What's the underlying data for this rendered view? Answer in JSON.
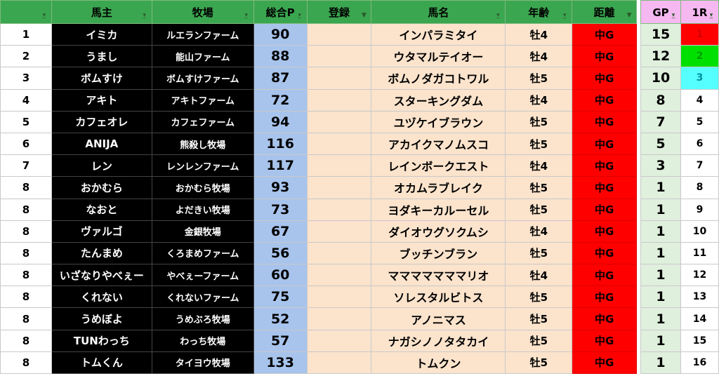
{
  "header": {
    "col_rank": "",
    "col_owner": "馬主",
    "col_farm": "牧場",
    "col_points": "総合P",
    "col_register": "登録",
    "col_horse": "馬名",
    "col_age": "年齢",
    "col_distance": "距離",
    "col_gp": "GP",
    "col_1r": "1R"
  },
  "icons": {
    "filter": "dropdown-filter-icon",
    "filter_active": "funnel-filter-icon"
  },
  "colors": {
    "header_green": "#3ba650",
    "header_pink": "#f5b8f0",
    "owner_bg": "#000000",
    "points_bg": "#a8c4ec",
    "horse_bg": "#fbe3cc",
    "distance_red": "#ff0000",
    "gp_bg": "#dff0dd",
    "rank1": "#ff0000",
    "rank2": "#00e000",
    "rank3": "#55ffff"
  },
  "rows": [
    {
      "rank": "1",
      "owner": "イミカ",
      "farm": "ルエランファーム",
      "points": "90",
      "register": "",
      "horse": "インパラミタイ",
      "age": "牡4",
      "distance": "中G",
      "gp": "15",
      "r1": "1"
    },
    {
      "rank": "2",
      "owner": "うまし",
      "farm": "能山ファーム",
      "points": "88",
      "register": "",
      "horse": "ウタマルテイオー",
      "age": "牡4",
      "distance": "中G",
      "gp": "12",
      "r1": "2"
    },
    {
      "rank": "3",
      "owner": "ボムすけ",
      "farm": "ボムすけファーム",
      "points": "87",
      "register": "",
      "horse": "ボムノダガコトワル",
      "age": "牡5",
      "distance": "中G",
      "gp": "10",
      "r1": "3"
    },
    {
      "rank": "4",
      "owner": "アキト",
      "farm": "アキトファーム",
      "points": "72",
      "register": "",
      "horse": "スターキングダム",
      "age": "牡4",
      "distance": "中G",
      "gp": "8",
      "r1": "4"
    },
    {
      "rank": "5",
      "owner": "カフェオレ",
      "farm": "カフェファーム",
      "points": "94",
      "register": "",
      "horse": "ユヅケイブラウン",
      "age": "牡5",
      "distance": "中G",
      "gp": "7",
      "r1": "5"
    },
    {
      "rank": "6",
      "owner": "ANIJA",
      "farm": "熊殺し牧場",
      "points": "116",
      "register": "",
      "horse": "アカイクマノムスコ",
      "age": "牡5",
      "distance": "中G",
      "gp": "5",
      "r1": "6"
    },
    {
      "rank": "7",
      "owner": "レン",
      "farm": "レンレンファーム",
      "points": "117",
      "register": "",
      "horse": "レインボークエスト",
      "age": "牡4",
      "distance": "中G",
      "gp": "3",
      "r1": "7"
    },
    {
      "rank": "8",
      "owner": "おかむら",
      "farm": "おかむら牧場",
      "points": "93",
      "register": "",
      "horse": "オカムラブレイク",
      "age": "牡5",
      "distance": "中G",
      "gp": "1",
      "r1": "8"
    },
    {
      "rank": "8",
      "owner": "なおと",
      "farm": "よだきい牧場",
      "points": "73",
      "register": "",
      "horse": "ヨダキーカルーセル",
      "age": "牡5",
      "distance": "中G",
      "gp": "1",
      "r1": "9"
    },
    {
      "rank": "8",
      "owner": "ヴァルゴ",
      "farm": "金銀牧場",
      "points": "67",
      "register": "",
      "horse": "ダイオウグソクムシ",
      "age": "牡4",
      "distance": "中G",
      "gp": "1",
      "r1": "10"
    },
    {
      "rank": "8",
      "owner": "たんまめ",
      "farm": "くろまめファーム",
      "points": "56",
      "register": "",
      "horse": "ブッチンブラン",
      "age": "牡5",
      "distance": "中G",
      "gp": "1",
      "r1": "11"
    },
    {
      "rank": "8",
      "owner": "いざなりやべぇー",
      "farm": "やべぇーファーム",
      "points": "60",
      "register": "",
      "horse": "マママママママリオ",
      "age": "牡4",
      "distance": "中G",
      "gp": "1",
      "r1": "12"
    },
    {
      "rank": "8",
      "owner": "くれない",
      "farm": "くれないファーム",
      "points": "75",
      "register": "",
      "horse": "ソレスタルビトス",
      "age": "牡5",
      "distance": "中G",
      "gp": "1",
      "r1": "13"
    },
    {
      "rank": "8",
      "owner": "うめぼよ",
      "farm": "うめぶろ牧場",
      "points": "52",
      "register": "",
      "horse": "アノニマス",
      "age": "牡5",
      "distance": "中G",
      "gp": "1",
      "r1": "14"
    },
    {
      "rank": "8",
      "owner": "TUNわっち",
      "farm": "わっち牧場",
      "points": "57",
      "register": "",
      "horse": "ナガシノノタタカイ",
      "age": "牡5",
      "distance": "中G",
      "gp": "1",
      "r1": "15"
    },
    {
      "rank": "8",
      "owner": "トムくん",
      "farm": "タイヨウ牧場",
      "points": "133",
      "register": "",
      "horse": "トムクン",
      "age": "牡5",
      "distance": "中G",
      "gp": "1",
      "r1": "16"
    }
  ]
}
